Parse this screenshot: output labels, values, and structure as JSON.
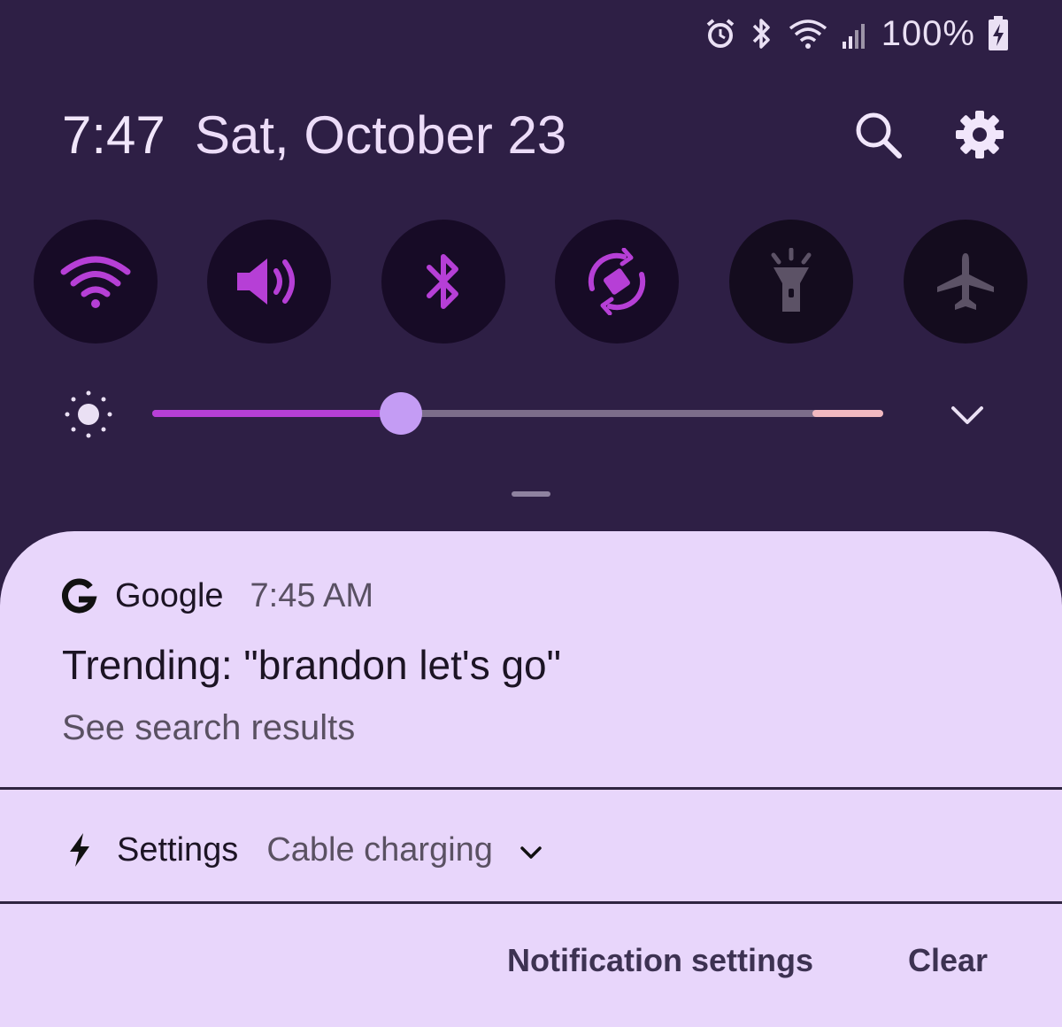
{
  "status_bar": {
    "battery": "100%",
    "icons": [
      "alarm-icon",
      "bluetooth-icon",
      "wifi-icon",
      "signal-icon",
      "battery-charging-icon"
    ]
  },
  "header": {
    "time": "7:47",
    "date": "Sat, October 23",
    "actions": [
      "search-icon",
      "gear-icon"
    ]
  },
  "quick_settings": [
    {
      "name": "wifi",
      "icon": "wifi-icon",
      "state": "on"
    },
    {
      "name": "sound",
      "icon": "volume-icon",
      "state": "on"
    },
    {
      "name": "bluetooth",
      "icon": "bluetooth-icon",
      "state": "on"
    },
    {
      "name": "auto-rotate",
      "icon": "rotate-icon",
      "state": "on"
    },
    {
      "name": "flashlight",
      "icon": "flashlight-icon",
      "state": "off"
    },
    {
      "name": "airplane-mode",
      "icon": "airplane-icon",
      "state": "off"
    }
  ],
  "brightness": {
    "level": 0.34
  },
  "colors": {
    "background": "#2e1f45",
    "tile_on_icon": "#b63fd6",
    "tile_off_icon": "#5c5266",
    "panel": "#e8d6fb",
    "slider_thumb": "#c49cf4"
  },
  "notification": {
    "app": "Google",
    "time": "7:45 AM",
    "title": "Trending: \"brandon let's go\"",
    "text": "See search results"
  },
  "charging": {
    "app": "Settings",
    "text": "Cable charging"
  },
  "footer": {
    "notification_settings": "Notification settings",
    "clear": "Clear"
  }
}
